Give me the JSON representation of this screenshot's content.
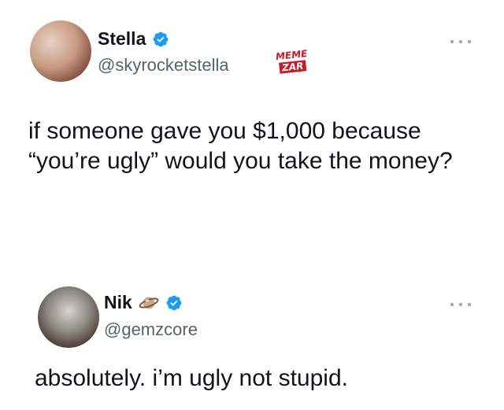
{
  "tweets": [
    {
      "name": "Stella",
      "handle": "@skyrocketstella",
      "verified": true,
      "text_lines": [
        "if someone gave you $1,000 because",
        "“you’re ugly” would you take the money?"
      ]
    },
    {
      "name": "Nik",
      "name_emoji_icon": "planet-icon",
      "handle": "@gemzcore",
      "verified": true,
      "text_lines": [
        "absolutely. i’m ugly not stupid."
      ]
    }
  ],
  "watermark": {
    "line1": "MEME",
    "line2": "ZAR"
  },
  "colors": {
    "verified_blue": "#1d9bf0",
    "text": "#0f1419",
    "secondary_text": "#536471",
    "watermark_red": "#c81b2c"
  }
}
